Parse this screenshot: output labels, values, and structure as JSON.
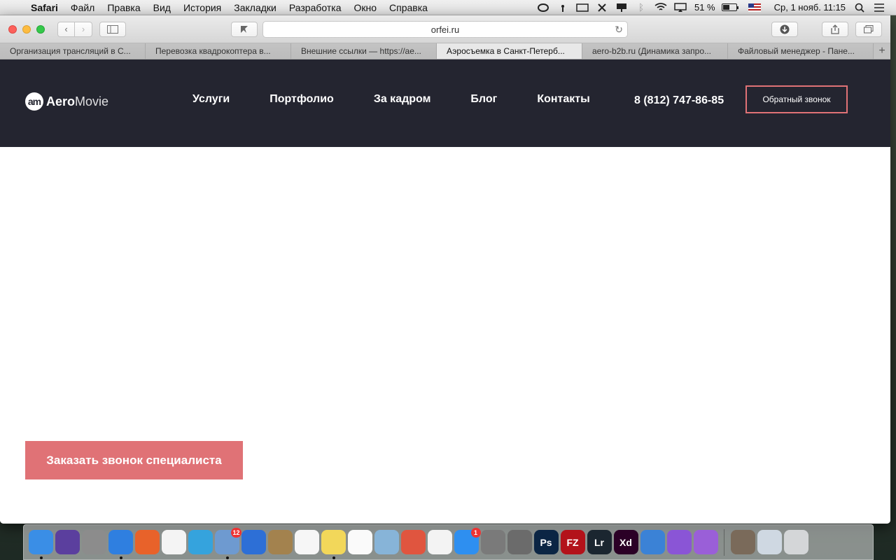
{
  "menubar": {
    "app_name": "Safari",
    "items": [
      "Файл",
      "Правка",
      "Вид",
      "История",
      "Закладки",
      "Разработка",
      "Окно",
      "Справка"
    ],
    "battery_text": "51 %",
    "battery_level": 0.51,
    "datetime": "Ср, 1 нояб.  11:15"
  },
  "browser": {
    "address": "orfei.ru",
    "tabs": [
      {
        "title": "Организация трансляций в С...",
        "active": false
      },
      {
        "title": "Перевозка квадрокоптера в...",
        "active": false
      },
      {
        "title": "Внешние ссылки — https://ae...",
        "active": false
      },
      {
        "title": "Аэросъемка в Санкт-Петерб...",
        "active": true
      },
      {
        "title": "aero-b2b.ru (Динамика запро...",
        "active": false
      },
      {
        "title": "Файловый менеджер - Пане...",
        "active": false
      }
    ]
  },
  "site": {
    "logo_mark": "am",
    "logo_bold": "Aero",
    "logo_light": "Movie",
    "nav": [
      "Услуги",
      "Портфолио",
      "За кадром",
      "Блог",
      "Контакты"
    ],
    "phone": "8 (812) 747-86-85",
    "callback_label": "Обратный звонок",
    "cta_label": "Заказать звонок специалиста"
  },
  "dock": {
    "apps": [
      {
        "name": "finder",
        "color": "#3a8ee6",
        "running": true
      },
      {
        "name": "siri",
        "color": "#5b3f9e",
        "running": false
      },
      {
        "name": "launchpad",
        "color": "#8c8c8c",
        "running": false
      },
      {
        "name": "safari",
        "color": "#2f7fe0",
        "running": true
      },
      {
        "name": "firefox",
        "color": "#e8622a",
        "running": false
      },
      {
        "name": "yandex",
        "color": "#f4f4f4",
        "running": false
      },
      {
        "name": "telegram",
        "color": "#35a3dd",
        "running": false
      },
      {
        "name": "mail",
        "color": "#6e9ad0",
        "running": true,
        "badge": "12"
      },
      {
        "name": "navigator",
        "color": "#2d6fd6",
        "running": false
      },
      {
        "name": "contacts",
        "color": "#a3824e",
        "running": false
      },
      {
        "name": "calendar",
        "color": "#f6f6f6",
        "running": false
      },
      {
        "name": "notes",
        "color": "#f2d75a",
        "running": true
      },
      {
        "name": "reminders",
        "color": "#fafafa",
        "running": false
      },
      {
        "name": "preview",
        "color": "#87b4d8",
        "running": false
      },
      {
        "name": "remote-desktop",
        "color": "#e0553f",
        "running": false
      },
      {
        "name": "photos",
        "color": "#f3f3f3",
        "running": false
      },
      {
        "name": "app-store",
        "color": "#2e8ff0",
        "running": false,
        "badge": "1"
      },
      {
        "name": "system-preferences",
        "color": "#7a7a7a",
        "running": false
      },
      {
        "name": "calculator",
        "color": "#6b6b6b",
        "running": false
      },
      {
        "name": "photoshop",
        "color": "#0b2544",
        "running": false,
        "label": "Ps"
      },
      {
        "name": "filezilla",
        "color": "#b3121a",
        "running": false,
        "label": "FZ"
      },
      {
        "name": "lightroom",
        "color": "#1b2630",
        "running": false,
        "label": "Lr"
      },
      {
        "name": "xd",
        "color": "#2b0026",
        "running": false,
        "label": "Xd"
      },
      {
        "name": "adwords",
        "color": "#3b82d6",
        "running": false
      },
      {
        "name": "store",
        "color": "#8a55d6",
        "running": false
      },
      {
        "name": "feedback",
        "color": "#9a5fd8",
        "running": false
      }
    ],
    "trailing": [
      {
        "name": "photo-stack",
        "color": "#7a6a5a"
      },
      {
        "name": "downloads-stack",
        "color": "#cfd8e2"
      },
      {
        "name": "trash",
        "color": "#d4d6d8"
      }
    ]
  }
}
